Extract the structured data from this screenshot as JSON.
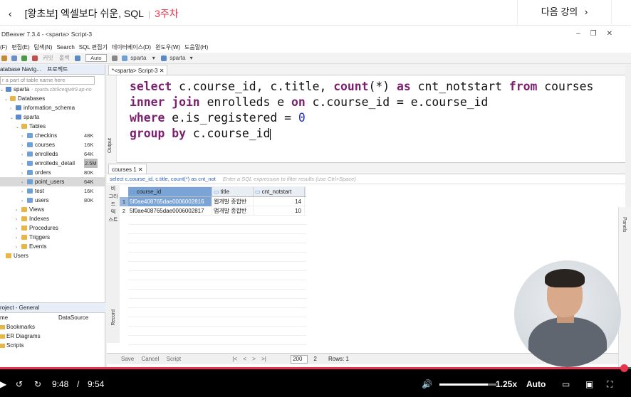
{
  "course": {
    "back": "‹",
    "title": "[왕초보] 엑셀보다 쉬운, SQL",
    "separator": "|",
    "week": "3주차",
    "next_lesson": "다음 강의"
  },
  "window": {
    "title": "DBeaver 7.3.4 - <sparta> Script-3"
  },
  "menu": [
    "(F)",
    "편집(E)",
    "탐색(N)",
    "Search",
    "SQL 편집기",
    "데이터베이스(D)",
    "윈도우(W)",
    "도움말(H)"
  ],
  "toolbar": {
    "auto": "Auto",
    "connection": "sparta",
    "schema": "sparta",
    "commit": "커밋",
    "rollback": "롤백"
  },
  "navigator": {
    "tab_label": "atabase Navig...",
    "projects_tab": "프로젝트",
    "filter_placeholder": "r a part of table name here",
    "connection": "sparta",
    "connection_url": "- sparta.cbt9ceqjwlr9.ap-no",
    "databases": "Databases",
    "schemas": [
      {
        "name": "information_schema"
      },
      {
        "name": "sparta"
      }
    ],
    "tables_label": "Tables",
    "tables": [
      {
        "name": "checkins",
        "size": "48K"
      },
      {
        "name": "courses",
        "size": "16K"
      },
      {
        "name": "enrolleds",
        "size": "64K"
      },
      {
        "name": "enrolleds_detail",
        "size": "2.5M"
      },
      {
        "name": "orders",
        "size": "80K"
      },
      {
        "name": "point_users",
        "size": "64K"
      },
      {
        "name": "test",
        "size": "16K"
      },
      {
        "name": "users",
        "size": "80K"
      }
    ],
    "other_folders": [
      "Views",
      "Indexes",
      "Procedures",
      "Triggers",
      "Events"
    ],
    "users": "Users"
  },
  "project": {
    "header": "roject - General",
    "col_name": "me",
    "col_source": "DataSource",
    "items": [
      "Bookmarks",
      "ER Diagrams",
      "Scripts"
    ]
  },
  "editor": {
    "tab": "*<sparta> Script-3",
    "output_label": "Output",
    "lines": [
      [
        {
          "t": "select ",
          "c": "kw"
        },
        {
          "t": "c.course_id, c.title, ",
          "c": "fn"
        },
        {
          "t": "count",
          "c": "kw"
        },
        {
          "t": "(*) ",
          "c": "fn"
        },
        {
          "t": "as ",
          "c": "kw"
        },
        {
          "t": "cnt_notstart ",
          "c": "fn"
        },
        {
          "t": "from ",
          "c": "kw"
        },
        {
          "t": "courses",
          "c": "fn"
        }
      ],
      [
        {
          "t": "inner join ",
          "c": "kw"
        },
        {
          "t": "enrolleds e ",
          "c": "fn"
        },
        {
          "t": "on ",
          "c": "kw"
        },
        {
          "t": "c.course_id = e.course_id",
          "c": "fn"
        }
      ],
      [
        {
          "t": "where ",
          "c": "kw"
        },
        {
          "t": "e.is_registered = ",
          "c": "fn"
        },
        {
          "t": "0",
          "c": "num"
        }
      ],
      [
        {
          "t": "group by ",
          "c": "kw"
        },
        {
          "t": "c.course_id",
          "c": "fn"
        }
      ]
    ]
  },
  "results": {
    "tab": "courses 1",
    "query_echo": "select c.course_id, c.title, count(*) as cnt_not",
    "filter_placeholder": "Enter a SQL expression to filter results (use Ctrl+Space)",
    "side_labels": [
      "비",
      "그리드",
      "텍",
      "스트"
    ],
    "record_label": "Record",
    "columns": [
      "course_id",
      "title",
      "cnt_notstart"
    ],
    "rows": [
      [
        "5f0ae408765dae0006002816",
        "웹개발 종합반",
        "14"
      ],
      [
        "5f0ae408765dae0006002817",
        "앱개발 종합반",
        "10"
      ]
    ],
    "status": {
      "save": "Save",
      "cancel": "Cancel",
      "script": "Script",
      "fetch_size": "200",
      "row_count": "2",
      "rows_label": "Rows: 1"
    },
    "panels_label": "Panels"
  },
  "player": {
    "current_time": "9:48",
    "separator": "/",
    "total_time": "9:54",
    "speed": "1.25x",
    "quality": "Auto",
    "progress": 0.99,
    "volume": 0.85
  }
}
